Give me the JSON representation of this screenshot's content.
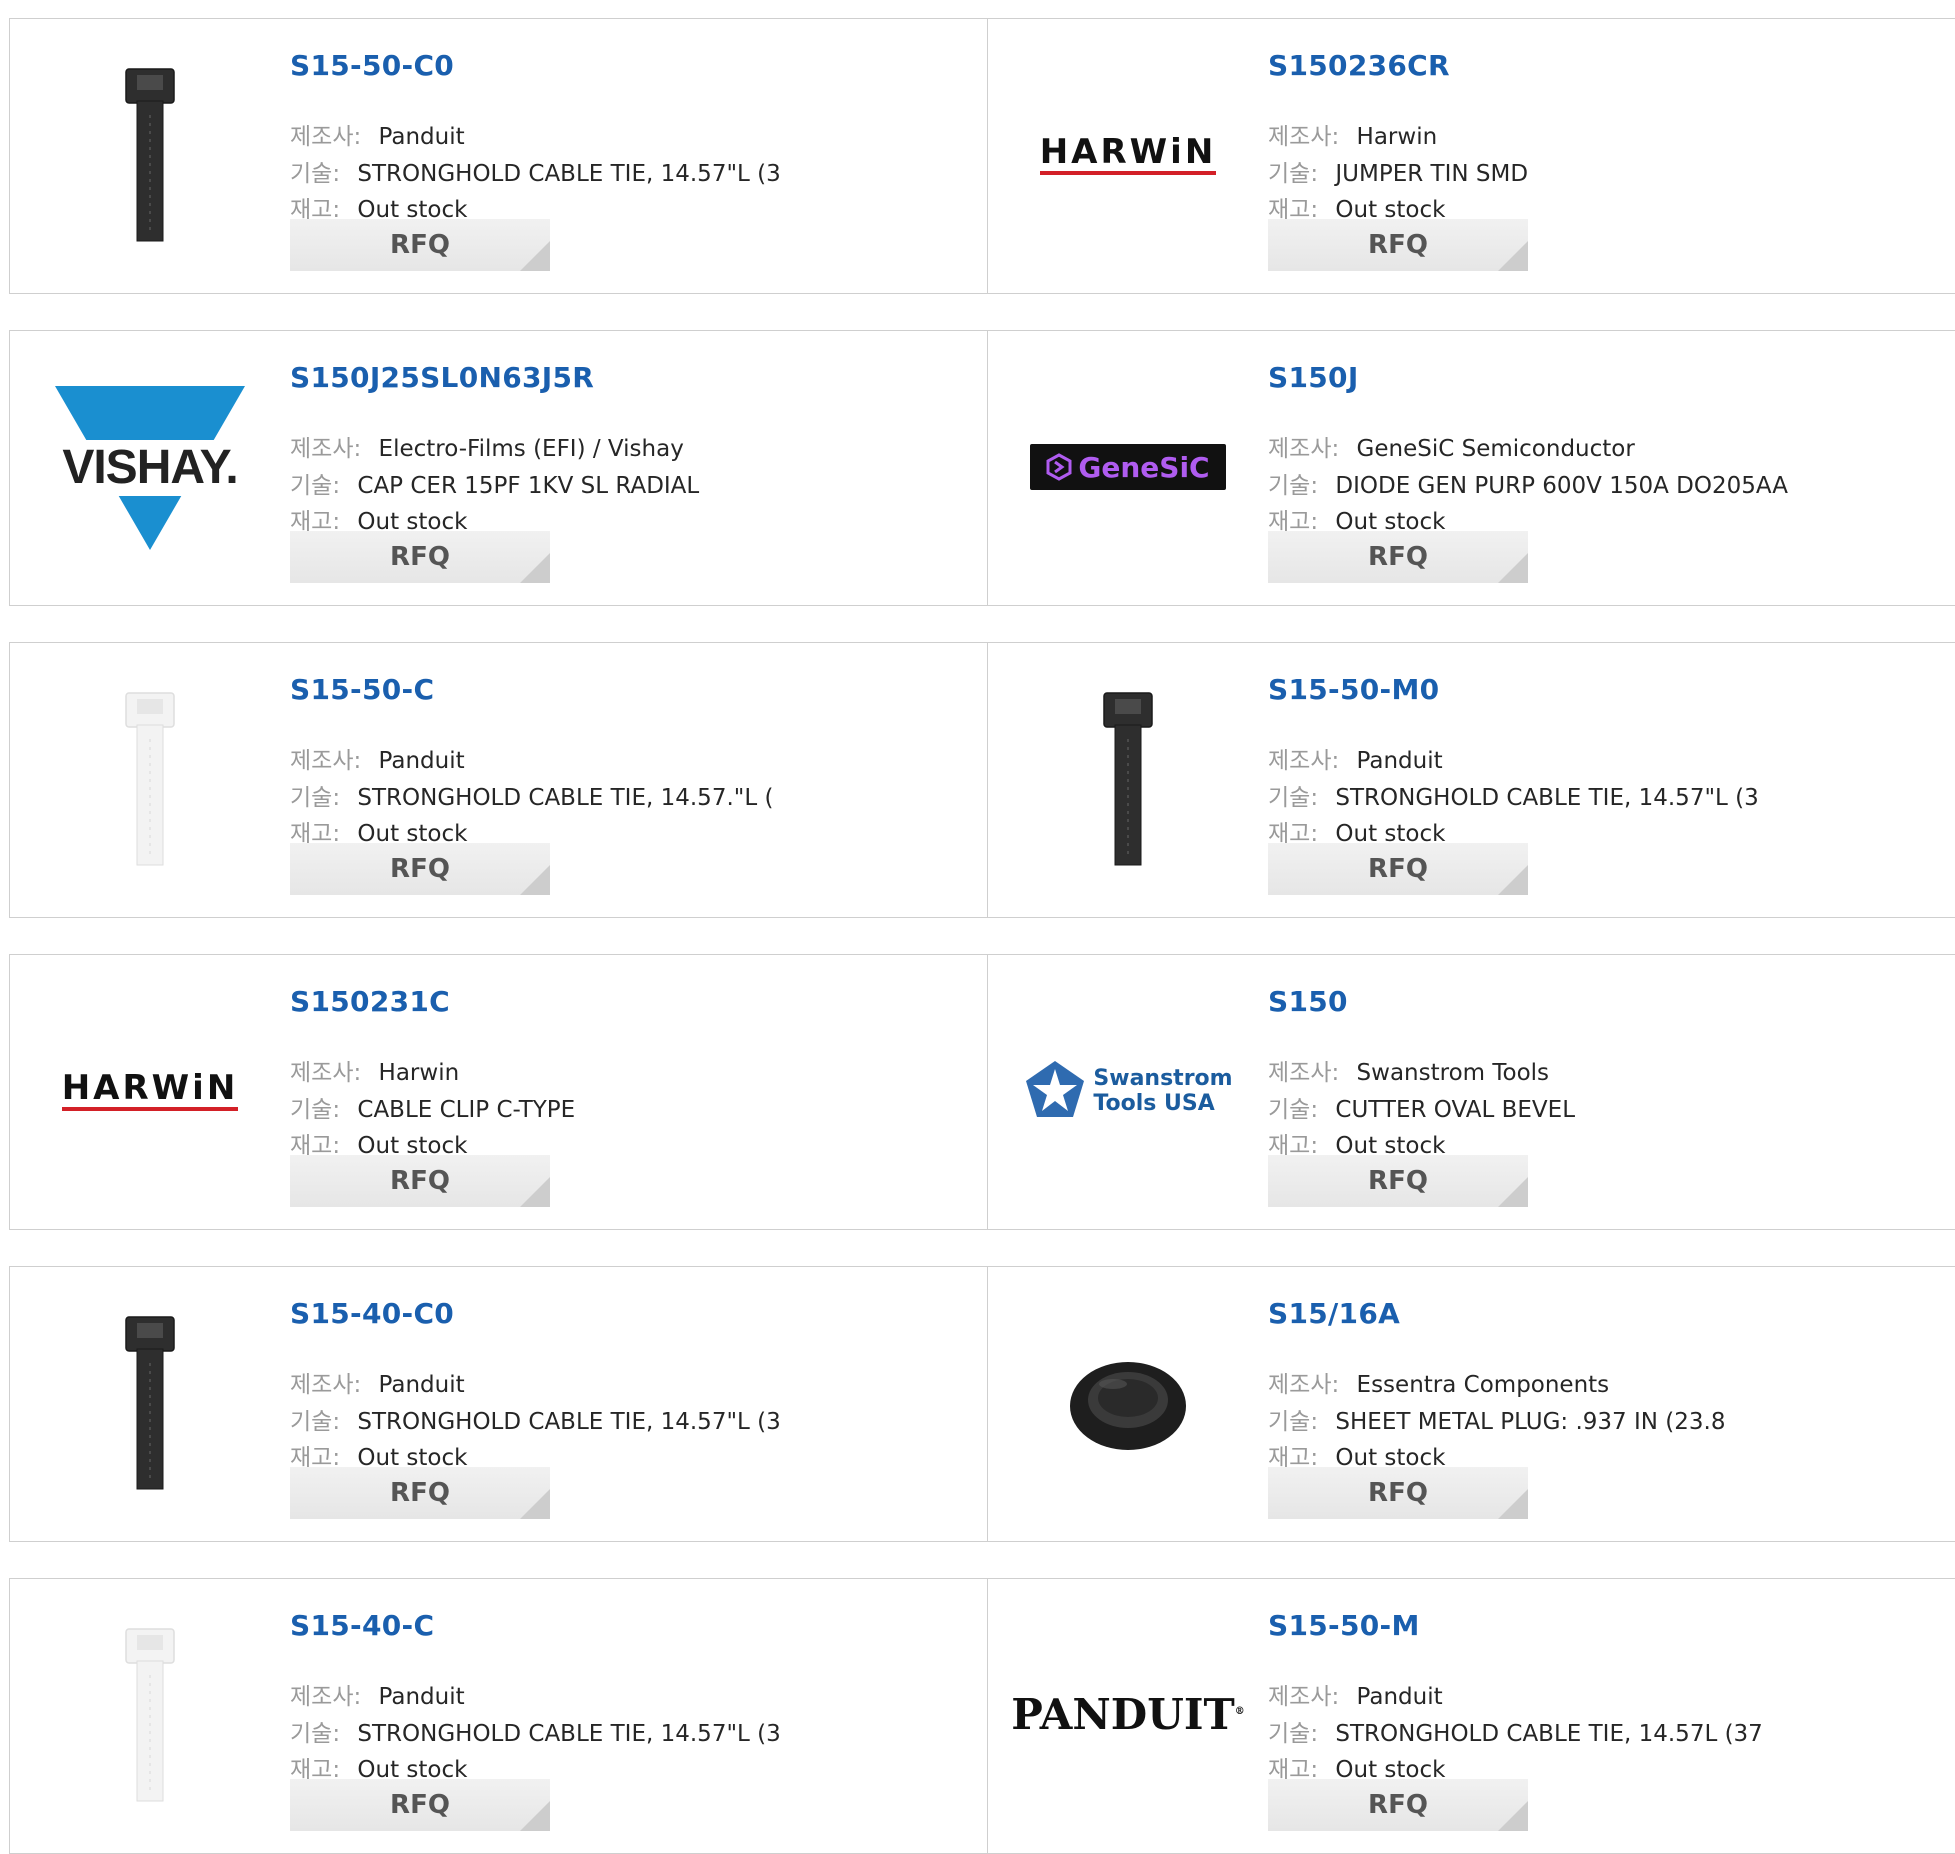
{
  "labels": {
    "manufacturer": "제조사:",
    "description": "기술:",
    "stock": "재고:"
  },
  "products": [
    {
      "part": "S15-50-C0",
      "manufacturer": "Panduit",
      "description": "STRONGHOLD CABLE TIE, 14.57\"L (3",
      "stock": "Out stock",
      "rfq": "RFQ",
      "image": "cable-tie-black"
    },
    {
      "part": "S150236CR",
      "manufacturer": "Harwin",
      "description": "JUMPER TIN SMD",
      "stock": "Out stock",
      "rfq": "RFQ",
      "image": "harwin-logo",
      "logo_text": "HARWiN"
    },
    {
      "part": "S150J25SL0N63J5R",
      "manufacturer": "Electro-Films (EFI) / Vishay",
      "description": "CAP CER 15PF 1KV SL RADIAL",
      "stock": "Out stock",
      "rfq": "RFQ",
      "image": "vishay-logo",
      "logo_text": "VISHAY."
    },
    {
      "part": "S150J",
      "manufacturer": "GeneSiC Semiconductor",
      "description": "DIODE GEN PURP 600V 150A DO205AA",
      "stock": "Out stock",
      "rfq": "RFQ",
      "image": "genesic-logo",
      "logo_text": "GeneSiC"
    },
    {
      "part": "S15-50-C",
      "manufacturer": "Panduit",
      "description": "STRONGHOLD CABLE TIE, 14.57.\"L (",
      "stock": "Out stock",
      "rfq": "RFQ",
      "image": "cable-tie-white"
    },
    {
      "part": "S15-50-M0",
      "manufacturer": "Panduit",
      "description": "STRONGHOLD CABLE TIE, 14.57\"L (3",
      "stock": "Out stock",
      "rfq": "RFQ",
      "image": "cable-tie-black"
    },
    {
      "part": "S150231C",
      "manufacturer": "Harwin",
      "description": "CABLE CLIP C-TYPE",
      "stock": "Out stock",
      "rfq": "RFQ",
      "image": "harwin-logo",
      "logo_text": "HARWiN"
    },
    {
      "part": "S150",
      "manufacturer": "Swanstrom Tools",
      "description": "CUTTER OVAL BEVEL",
      "stock": "Out stock",
      "rfq": "RFQ",
      "image": "swanstrom-logo",
      "logo_text": "Swanstrom Tools USA",
      "logo_line1": "Swanstrom",
      "logo_line2": "Tools USA"
    },
    {
      "part": "S15-40-C0",
      "manufacturer": "Panduit",
      "description": "STRONGHOLD CABLE TIE, 14.57\"L (3",
      "stock": "Out stock",
      "rfq": "RFQ",
      "image": "cable-tie-black"
    },
    {
      "part": "S15/16A",
      "manufacturer": "Essentra Components",
      "description": "SHEET METAL PLUG: .937 IN (23.8",
      "stock": "Out stock",
      "rfq": "RFQ",
      "image": "sheet-metal-plug"
    },
    {
      "part": "S15-40-C",
      "manufacturer": "Panduit",
      "description": "STRONGHOLD CABLE TIE, 14.57\"L (3",
      "stock": "Out stock",
      "rfq": "RFQ",
      "image": "cable-tie-white"
    },
    {
      "part": "S15-50-M",
      "manufacturer": "Panduit",
      "description": "STRONGHOLD CABLE TIE, 14.57L (37",
      "stock": "Out stock",
      "rfq": "RFQ",
      "image": "panduit-logo",
      "logo_text": "PANDUIT"
    }
  ],
  "colors": {
    "part_link": "#1a5fae",
    "label": "#9a9a9a",
    "border": "#cfcfcf",
    "harwin_red": "#d32027",
    "vishay_blue": "#1a8fd0"
  }
}
